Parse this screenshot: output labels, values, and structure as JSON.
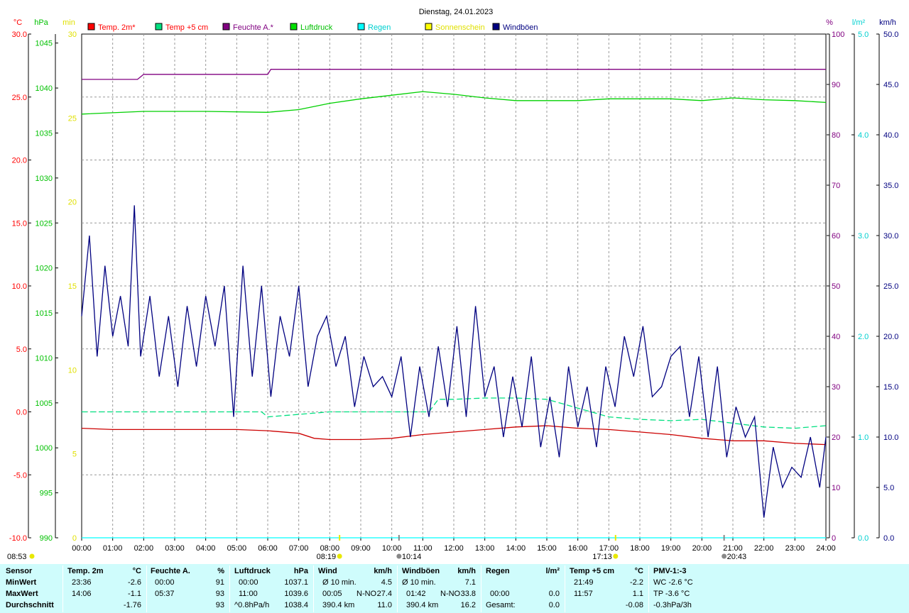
{
  "title": "Dienstag, 24.01.2023",
  "legend": [
    {
      "label": "Temp. 2m*",
      "color": "#ff0000",
      "text_color": "#ff0000"
    },
    {
      "label": "Temp +5 cm",
      "color": "#00e080",
      "text_color": "#ff0000"
    },
    {
      "label": "Feuchte A.*",
      "color": "#800080",
      "text_color": "#800080"
    },
    {
      "label": "Luftdruck",
      "color": "#00e000",
      "text_color": "#00c000"
    },
    {
      "label": "Regen",
      "color": "#00ffff",
      "text_color": "#00d0d0"
    },
    {
      "label": "Sonnenschein",
      "color": "#ffff00",
      "text_color": "#e0e000"
    },
    {
      "label": "Windböen",
      "color": "#000080",
      "text_color": "#000080"
    }
  ],
  "axes": {
    "temp": {
      "unit": "°C",
      "color": "#ff0000",
      "ticks": [
        "30.0",
        "25.0",
        "20.0",
        "15.0",
        "10.0",
        "5.0",
        "0.0",
        "-5.0",
        "-10.0"
      ]
    },
    "pressure": {
      "unit": "hPa",
      "color": "#00c000",
      "ticks": [
        "1045",
        "1040",
        "1035",
        "1030",
        "1025",
        "1020",
        "1015",
        "1010",
        "1005",
        "1000",
        "995",
        "990"
      ]
    },
    "sun": {
      "unit": "min",
      "color": "#e0e000",
      "ticks": [
        "30",
        "25",
        "20",
        "15",
        "10",
        "5",
        "0"
      ]
    },
    "humidity": {
      "unit": "%",
      "color": "#800080",
      "ticks": [
        "100",
        "90",
        "80",
        "70",
        "60",
        "50",
        "40",
        "30",
        "20",
        "10",
        "0"
      ]
    },
    "rain": {
      "unit": "l/m²",
      "color": "#00d0d0",
      "ticks": [
        "5.0",
        "4.0",
        "3.0",
        "2.0",
        "1.0",
        "0.0"
      ]
    },
    "wind": {
      "unit": "km/h",
      "color": "#000080",
      "ticks": [
        "50.0",
        "45.0",
        "40.0",
        "35.0",
        "30.0",
        "25.0",
        "20.0",
        "15.0",
        "10.0",
        "5.0",
        "0.0"
      ]
    },
    "time_ticks": [
      "00:00",
      "01:00",
      "02:00",
      "03:00",
      "04:00",
      "05:00",
      "06:00",
      "07:00",
      "08:00",
      "09:00",
      "10:00",
      "11:00",
      "12:00",
      "13:00",
      "14:00",
      "15:00",
      "16:00",
      "17:00",
      "18:00",
      "19:00",
      "20:00",
      "21:00",
      "22:00",
      "23:00",
      "24:00"
    ]
  },
  "markers": {
    "sunrise_label": "08:19",
    "sunset_label": "17:13",
    "sunshine_label": "08:53",
    "maxtemp_label": "10:14",
    "mintemp_label": "20:43"
  },
  "chart_data": {
    "type": "line",
    "title": "Dienstag, 24.01.2023",
    "x_unit": "hour",
    "xlim": [
      0,
      24
    ],
    "series": [
      {
        "name": "Temp. 2m*",
        "axis": "temp",
        "ylim": [
          -10,
          30
        ],
        "color": "#cc0000",
        "x": [
          0,
          1,
          2,
          3,
          4,
          5,
          6,
          7,
          7.5,
          8,
          9,
          10,
          11,
          12,
          13,
          14,
          15,
          16,
          17,
          18,
          19,
          20,
          21,
          22,
          23,
          24
        ],
        "y": [
          -1.3,
          -1.4,
          -1.4,
          -1.4,
          -1.4,
          -1.4,
          -1.5,
          -1.7,
          -2.1,
          -2.2,
          -2.2,
          -2.1,
          -1.8,
          -1.6,
          -1.4,
          -1.2,
          -1.1,
          -1.3,
          -1.4,
          -1.6,
          -1.8,
          -2.1,
          -2.3,
          -2.3,
          -2.5,
          -2.6
        ]
      },
      {
        "name": "Temp +5 cm",
        "axis": "temp",
        "ylim": [
          -10,
          30
        ],
        "color": "#00e080",
        "x": [
          0,
          5.8,
          6,
          8,
          11.2,
          11.5,
          12,
          13,
          14,
          15,
          16,
          17,
          18,
          19,
          20,
          21,
          22,
          23,
          24
        ],
        "y": [
          0.0,
          0.0,
          -0.4,
          0.0,
          0.0,
          1.0,
          1.0,
          1.1,
          1.1,
          1.0,
          0.3,
          -0.4,
          -0.6,
          -0.7,
          -0.6,
          -0.9,
          -1.2,
          -1.3,
          -1.1
        ]
      },
      {
        "name": "Feuchte A.*",
        "axis": "humidity",
        "ylim": [
          0,
          100
        ],
        "color": "#800080",
        "x": [
          0,
          1.8,
          2,
          6,
          6.1,
          6.5,
          7,
          24
        ],
        "y": [
          91,
          91,
          92,
          92,
          93,
          93,
          93,
          93
        ]
      },
      {
        "name": "Luftdruck",
        "axis": "pressure",
        "ylim": [
          990,
          1046
        ],
        "color": "#00d000",
        "x": [
          0,
          2,
          4,
          6,
          7,
          8,
          9,
          10,
          11,
          12,
          13,
          14,
          15,
          16,
          17,
          18,
          19,
          20,
          21,
          22,
          23,
          24
        ],
        "y": [
          1037.1,
          1037.4,
          1037.4,
          1037.3,
          1037.6,
          1038.3,
          1038.8,
          1039.2,
          1039.6,
          1039.3,
          1038.9,
          1038.6,
          1038.6,
          1038.6,
          1038.8,
          1038.8,
          1038.8,
          1038.6,
          1038.9,
          1038.7,
          1038.6,
          1038.4
        ]
      },
      {
        "name": "Regen",
        "axis": "rain",
        "ylim": [
          0,
          5
        ],
        "color": "#00ffff",
        "x": [
          0,
          24
        ],
        "y": [
          0,
          0
        ]
      },
      {
        "name": "Windböen",
        "axis": "wind",
        "ylim": [
          0,
          50
        ],
        "color": "#000080",
        "x": [
          0,
          0.25,
          0.5,
          0.75,
          1,
          1.25,
          1.5,
          1.7,
          1.9,
          2.2,
          2.5,
          2.8,
          3.1,
          3.4,
          3.7,
          4,
          4.3,
          4.6,
          4.9,
          5.2,
          5.5,
          5.8,
          6.1,
          6.4,
          6.7,
          7,
          7.3,
          7.6,
          7.9,
          8.2,
          8.5,
          8.8,
          9.1,
          9.4,
          9.7,
          10,
          10.3,
          10.6,
          10.9,
          11.2,
          11.5,
          11.8,
          12.1,
          12.4,
          12.7,
          13,
          13.3,
          13.6,
          13.9,
          14.2,
          14.5,
          14.8,
          15.1,
          15.4,
          15.7,
          16,
          16.3,
          16.6,
          16.9,
          17.2,
          17.5,
          17.8,
          18.1,
          18.4,
          18.7,
          19,
          19.3,
          19.6,
          19.9,
          20.2,
          20.5,
          20.8,
          21.1,
          21.4,
          21.7,
          22,
          22.3,
          22.6,
          22.9,
          23.2,
          23.5,
          23.8,
          24
        ],
        "y": [
          22,
          30,
          18,
          27,
          20,
          24,
          19,
          33,
          18,
          24,
          16,
          22,
          15,
          23,
          17,
          24,
          19,
          25,
          12,
          27,
          16,
          25,
          14,
          22,
          18,
          25,
          15,
          20,
          22,
          17,
          20,
          13,
          18,
          15,
          16,
          14,
          18,
          10,
          17,
          12,
          19,
          13,
          21,
          12,
          23,
          14,
          17,
          10,
          16,
          11,
          18,
          9,
          14,
          8,
          17,
          11,
          15,
          9,
          17,
          13,
          20,
          16,
          21,
          14,
          15,
          18,
          19,
          12,
          18,
          10,
          17,
          8,
          13,
          10,
          12,
          2,
          9,
          5,
          7,
          6,
          10,
          5,
          10
        ]
      }
    ]
  },
  "stats": {
    "sensor": {
      "header": "Sensor",
      "rows": [
        "MinWert",
        "MaxWert",
        "Durchschnitt"
      ]
    },
    "temp2m": {
      "header": "Temp. 2m",
      "unit": "°C",
      "c1": [
        "23:36",
        "14:06",
        ""
      ],
      "c2": [
        "-2.6",
        "-1.1",
        "-1.76"
      ]
    },
    "humidity": {
      "header": "Feuchte A.",
      "unit": "%",
      "c1": [
        "00:00",
        "05:37",
        ""
      ],
      "c2": [
        "91",
        "93",
        "93"
      ]
    },
    "pressure": {
      "header": "Luftdruck",
      "unit": "hPa",
      "c1": [
        "00:00",
        "11:00",
        "^0.8hPa/h"
      ],
      "c2": [
        "1037.1",
        "1039.6",
        "1038.4"
      ]
    },
    "wind": {
      "header": "Wind",
      "unit": "km/h",
      "c1": [
        "Ø 10 min.",
        "00:05",
        "390.4 km"
      ],
      "c2": [
        "",
        "N-NO",
        ""
      ],
      "c3": [
        "4.5",
        "27.4",
        "11.0"
      ]
    },
    "gusts": {
      "header": "Windböen",
      "unit": "km/h",
      "c1": [
        "Ø 10 min.",
        "01:42",
        "390.4 km"
      ],
      "c2": [
        "",
        "N-NO",
        ""
      ],
      "c3": [
        "7.1",
        "33.8",
        "16.2"
      ]
    },
    "rain": {
      "header": "Regen",
      "unit": "l/m²",
      "c1": [
        "",
        "00:00",
        "Gesamt:"
      ],
      "c2": [
        "",
        "0.0",
        "0.0"
      ]
    },
    "temp5": {
      "header": "Temp +5 cm",
      "unit": "°C",
      "c1": [
        "21:49",
        "11:57",
        ""
      ],
      "c2": [
        "-2.2",
        "1.1",
        "-0.08"
      ]
    },
    "pmv": {
      "header": "PMV-1:-3",
      "rows": [
        "WC -2.6 °C",
        "TP -3.6 °C",
        "-0.3hPa/3h"
      ]
    }
  }
}
